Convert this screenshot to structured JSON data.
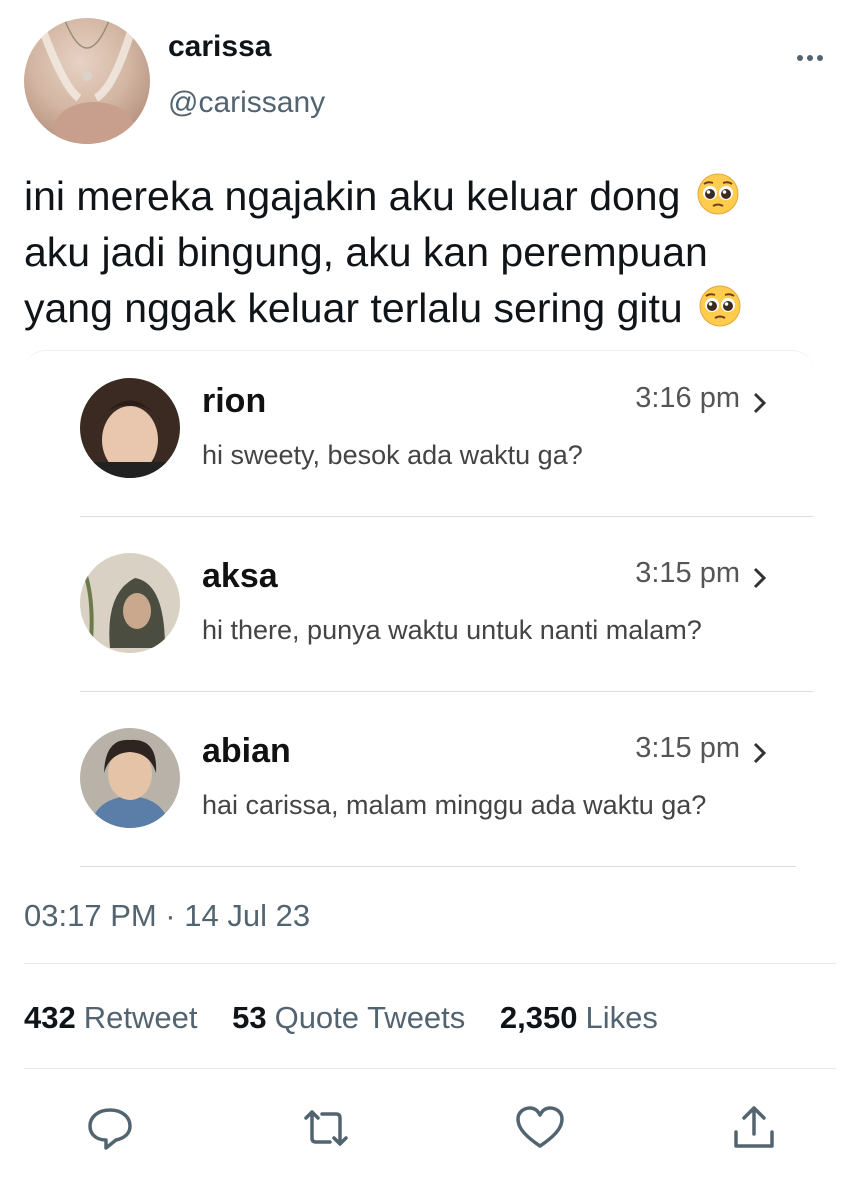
{
  "author": {
    "display_name": "carissa",
    "handle": "@carissany"
  },
  "tweet": {
    "text_line1": "ini mereka ngajakin aku keluar dong ",
    "text_line2": "aku jadi bingung, aku kan perempuan",
    "text_line3": "yang nggak keluar terlalu sering gitu ",
    "emoji": "pleading-face-icon"
  },
  "messages": [
    {
      "name": "rion",
      "time": "3:16 pm",
      "preview": "hi sweety, besok ada waktu ga?"
    },
    {
      "name": "aksa",
      "time": "3:15 pm",
      "preview": "hi there, punya waktu untuk nanti malam?"
    },
    {
      "name": "abian",
      "time": "3:15 pm",
      "preview": "hai carissa, malam minggu ada waktu ga?"
    }
  ],
  "meta": {
    "timestamp": "03:17 PM · 14 Jul 23"
  },
  "stats": {
    "retweets": "432",
    "retweets_label": "Retweet",
    "quotes": "53",
    "quotes_label": "Quote Tweets",
    "likes": "2,350",
    "likes_label": "Likes"
  },
  "actions": [
    "reply-icon",
    "retweet-icon",
    "like-icon",
    "share-icon"
  ],
  "colors": {
    "text": "#0f1419",
    "secondary": "#536471",
    "divider": "#e6e9ec"
  }
}
